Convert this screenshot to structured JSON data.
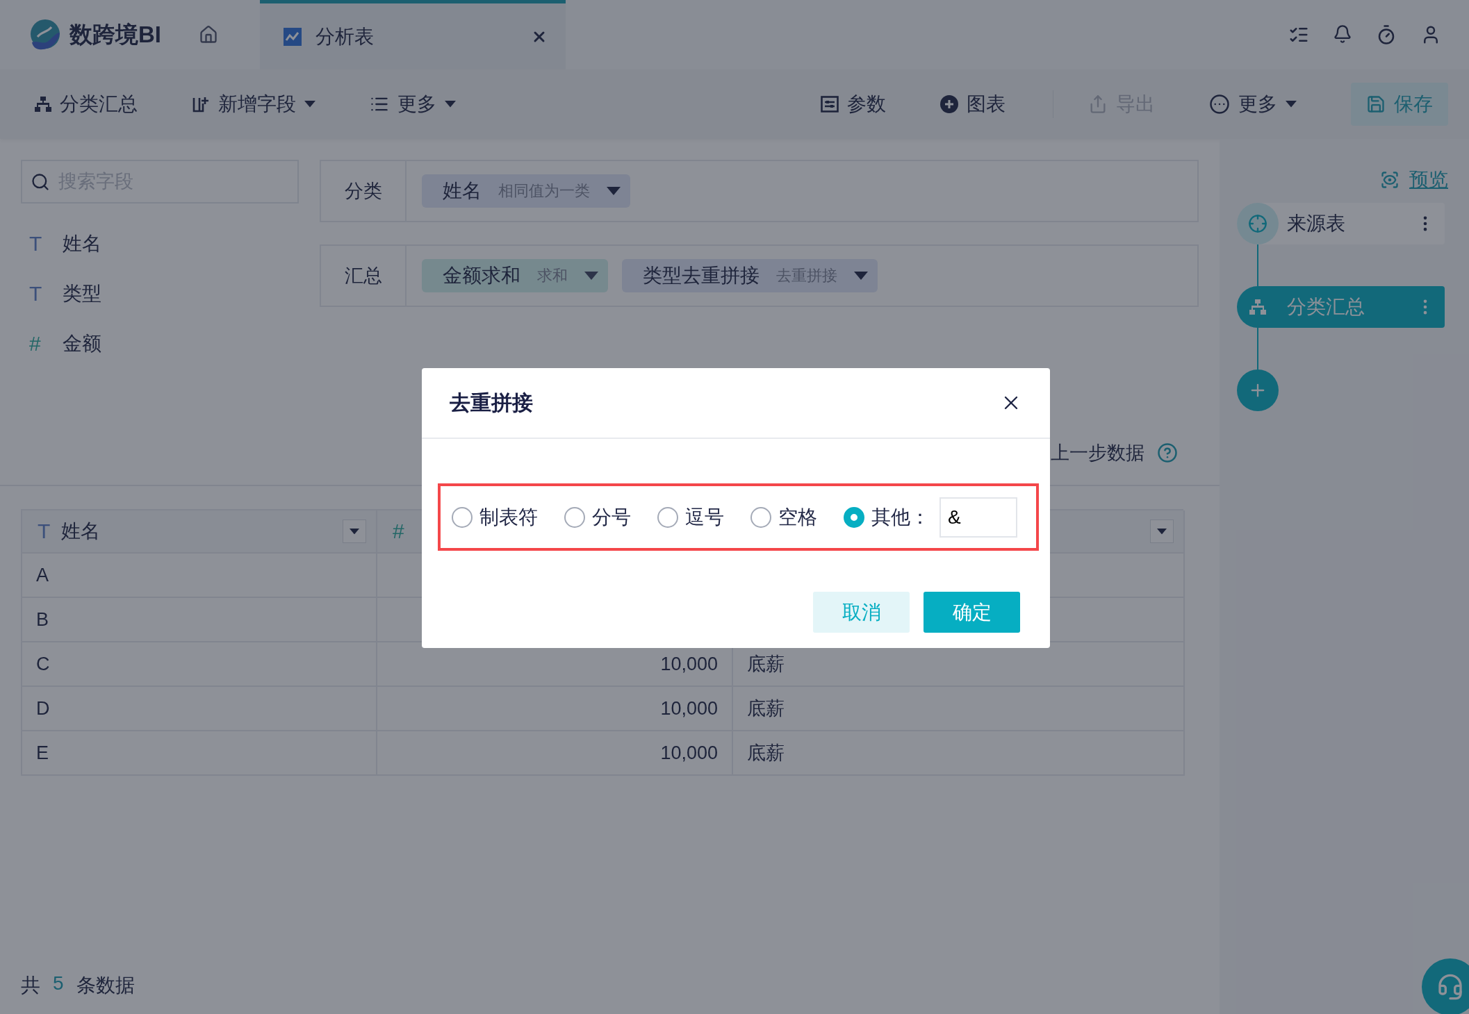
{
  "app": {
    "logo_text": "数跨境BI"
  },
  "tabs": [
    {
      "label": "分析表",
      "selected": true
    }
  ],
  "toolbar": {
    "left": [
      {
        "label": "分类汇总",
        "dropdown": false
      },
      {
        "label": "新增字段",
        "dropdown": true
      },
      {
        "label": "更多",
        "dropdown": true
      }
    ],
    "right": [
      {
        "label": "参数",
        "dropdown": false,
        "disabled": false,
        "kind": "plain"
      },
      {
        "label": "图表",
        "dropdown": false,
        "disabled": false,
        "kind": "plain"
      },
      {
        "label": "导出",
        "dropdown": false,
        "disabled": true,
        "kind": "plain"
      },
      {
        "label": "更多",
        "dropdown": true,
        "disabled": false,
        "kind": "plain"
      },
      {
        "label": "保存",
        "dropdown": false,
        "disabled": false,
        "kind": "primary"
      }
    ]
  },
  "sidebar": {
    "search": {
      "placeholder": "搜索字段"
    },
    "fields": [
      {
        "mark": "T",
        "name": "姓名",
        "kind": "text"
      },
      {
        "mark": "T",
        "name": "类型",
        "kind": "text"
      },
      {
        "mark": "#",
        "name": "金额",
        "kind": "number"
      }
    ]
  },
  "config": [
    {
      "label": "分类",
      "chips": [
        {
          "name": "姓名",
          "mode": "相同值为一类",
          "kind": "dimension"
        }
      ]
    },
    {
      "label": "汇总",
      "chips": [
        {
          "name": "金额求和",
          "mode": "求和",
          "kind": "measure"
        },
        {
          "name": "类型去重拼接",
          "mode": "去重拼接",
          "kind": "dimension"
        }
      ]
    }
  ],
  "hint": "上一步数据",
  "table": {
    "columns": [
      {
        "mark": "T",
        "title": "姓名",
        "dropdown": true,
        "kind": "text"
      },
      {
        "mark": "#",
        "kind": "number"
      },
      {
        "dropdown": true,
        "kind": "text"
      }
    ],
    "rows": [
      [
        "A"
      ],
      [
        "B"
      ],
      [
        "C",
        "10,000",
        "底薪"
      ],
      [
        "D",
        "10,000",
        "底薪"
      ],
      [
        "E",
        "10,000",
        "底薪"
      ]
    ]
  },
  "footer": {
    "prefix": "共",
    "count": "5",
    "suffix": "条数据"
  },
  "flow": {
    "preview": "预览",
    "nodes": [
      {
        "label": "来源表",
        "kind": "source",
        "selected": false
      },
      {
        "label": "分类汇总",
        "kind": "step",
        "selected": true
      }
    ]
  },
  "dialog": {
    "title": "去重拼接",
    "options": [
      {
        "label": "制表符",
        "selected": false
      },
      {
        "label": "分号",
        "selected": false
      },
      {
        "label": "逗号",
        "selected": false
      },
      {
        "label": "空格",
        "selected": false
      },
      {
        "label": "其他：",
        "selected": true
      }
    ],
    "custom_value": "&",
    "buttons": [
      {
        "label": "取消",
        "kind": "secondary"
      },
      {
        "label": "确定",
        "kind": "primary"
      }
    ]
  }
}
